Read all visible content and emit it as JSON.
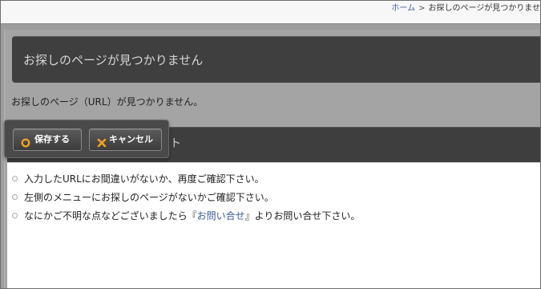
{
  "breadcrumb": {
    "home": "ホーム",
    "separator": ">",
    "current": "お探しのページが見つかりませ"
  },
  "page": {
    "title": "お探しのページが見つかりません",
    "intro": "お探しのページ（URL）が見つかりません。"
  },
  "toolbar": {
    "save_label": "保存する",
    "cancel_label": "キャンセル",
    "save_icon": "ring-icon",
    "cancel_icon": "x-icon",
    "icon_color": "#f0a020"
  },
  "tips": {
    "item1": "入力したURLにお間違いがないか、再度ご確認下さい。",
    "item2": "左側のメニューにお探しのページがないかご確認下さい。",
    "item3_before": "なにかご不明な点などございましたら『",
    "item3_link": "お問い合せ",
    "item3_after": "』よりお問い合せ下さい。"
  }
}
